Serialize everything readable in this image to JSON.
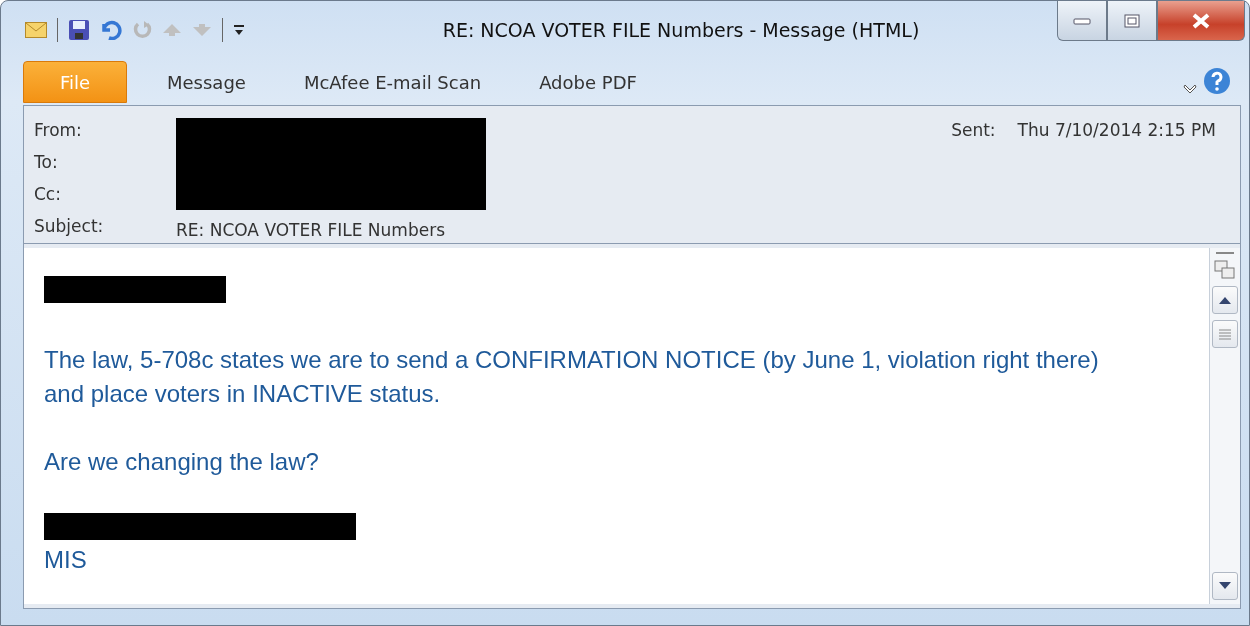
{
  "window": {
    "title": "RE: NCOA VOTER FILE Numbers  -  Message (HTML)"
  },
  "tabs": [
    {
      "label": "File",
      "selected": true,
      "kind": "file"
    },
    {
      "label": "Message",
      "selected": false,
      "kind": "tab"
    },
    {
      "label": "McAfee E-mail Scan",
      "selected": false,
      "kind": "tab"
    },
    {
      "label": "Adobe PDF",
      "selected": false,
      "kind": "tab"
    }
  ],
  "header": {
    "from_label": "From:",
    "to_label": "To:",
    "cc_label": "Cc:",
    "subject_label": "Subject:",
    "subject": "RE: NCOA VOTER FILE Numbers",
    "sent_label": "Sent:",
    "sent": "Thu 7/10/2014 2:15 PM"
  },
  "body": {
    "paragraphs": [
      {
        "lines": [
          "The law, 5-708c states we are to send a CONFIRMATION NOTICE (by June 1, violation right there)",
          "and place voters in INACTIVE status."
        ]
      },
      {
        "lines": [
          "Are we changing the law?"
        ]
      }
    ],
    "signature": "MIS"
  }
}
